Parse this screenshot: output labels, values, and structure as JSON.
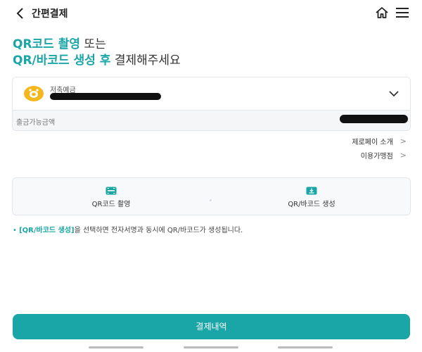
{
  "header": {
    "title": "간편결제"
  },
  "headline": {
    "line1_accent": "QR코드 촬영",
    "line1_rest": " 또는",
    "line2_accent": "QR/바코드 생성 후",
    "line2_rest": " 결제해주세요"
  },
  "account": {
    "name": "저축예금",
    "available_label": "출금가능금액"
  },
  "links": {
    "intro": "제로페이 소개",
    "merchants": "이용가맹점"
  },
  "options": {
    "scan": "QR코드 촬영",
    "generate": "QR/바코드 생성"
  },
  "note": {
    "bullet": "•",
    "highlight": "[QR/바코드 생성]",
    "text": "을 선택하면 전자서명과 동시에 QR/바코드가 생성됩니다."
  },
  "pay_button": {
    "label": "결제내역"
  },
  "colors": {
    "accent": "#1aa6a6",
    "coin": "#f5b81c"
  }
}
